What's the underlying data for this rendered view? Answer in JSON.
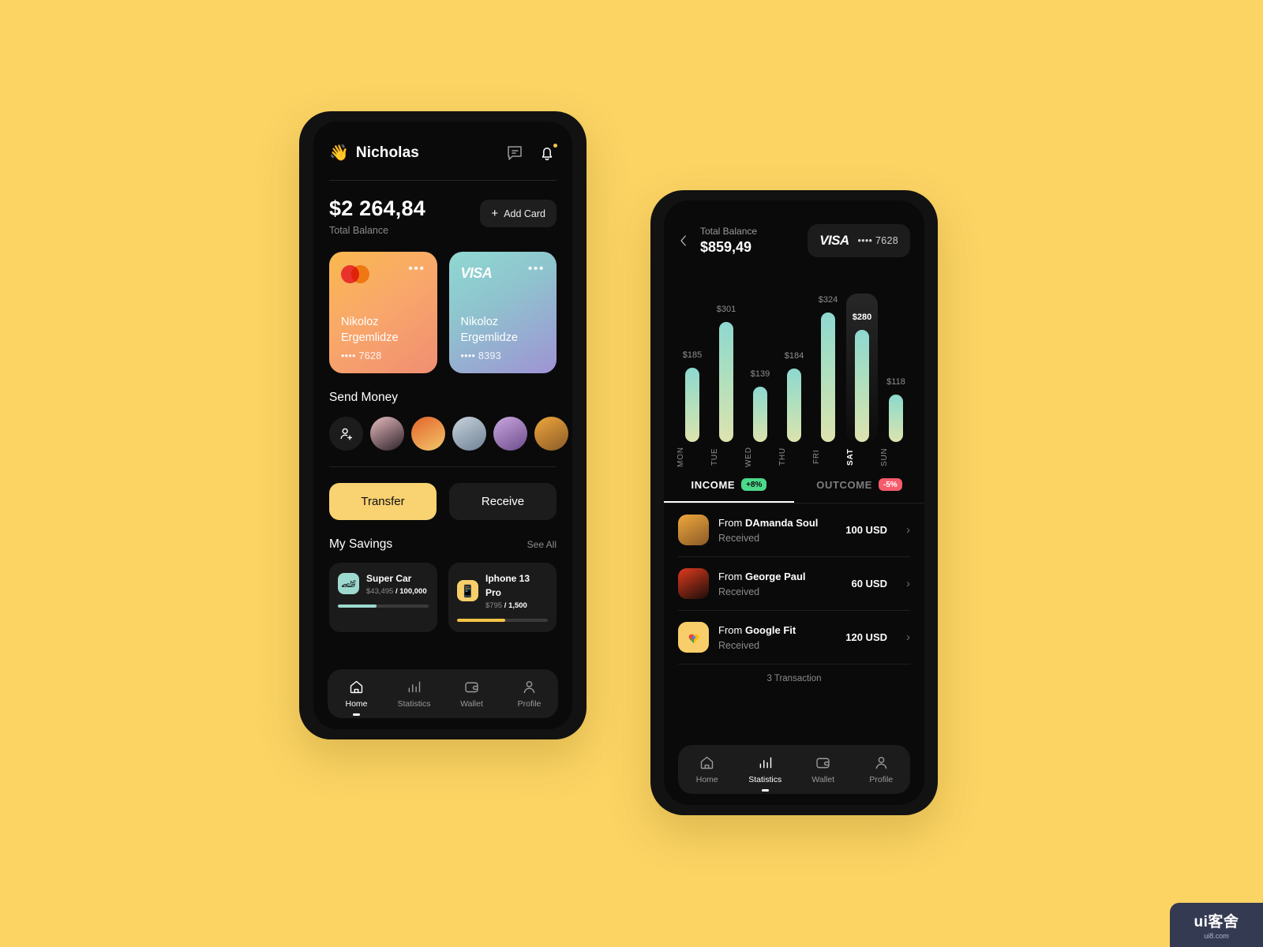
{
  "background_color": "#FBD464",
  "phone1": {
    "header": {
      "wave_emoji": "👋",
      "user_name": "Nicholas",
      "message_icon": "message-bubble-icon",
      "bell_icon": "notification-bell-icon"
    },
    "balance": {
      "amount": "$2 264,84",
      "label": "Total Balance",
      "add_card_label": "Add Card"
    },
    "cards": [
      {
        "brand": "mastercard",
        "holder_line1": "Nikoloz",
        "holder_line2": "Ergemlidze",
        "number": "•••• 7628",
        "menu": "•••"
      },
      {
        "brand": "VISA",
        "holder_line1": "Nikoloz",
        "holder_line2": "Ergemlidze",
        "number": "•••• 8393",
        "menu": "•••"
      }
    ],
    "send_money": {
      "title": "Send Money",
      "add_contact_icon": "add-person-icon",
      "contacts": [
        {
          "name": "contact-1",
          "colors": [
            "#E8BCC0",
            "#2C2028"
          ]
        },
        {
          "name": "contact-2",
          "colors": [
            "#E2642A",
            "#F4C66B"
          ]
        },
        {
          "name": "contact-3",
          "colors": [
            "#C9D3DC",
            "#6E8296"
          ]
        },
        {
          "name": "contact-4",
          "colors": [
            "#C9A8E0",
            "#6E4C8C"
          ]
        },
        {
          "name": "contact-5",
          "colors": [
            "#F0A83C",
            "#8A5A28"
          ]
        }
      ]
    },
    "actions": {
      "transfer_label": "Transfer",
      "receive_label": "Receive"
    },
    "savings": {
      "title": "My Savings",
      "see_all_label": "See All",
      "items": [
        {
          "icon": "race-car-icon",
          "emoji": "🏎",
          "name": "Super Car",
          "current": "$43,495",
          "separator": " / ",
          "goal": "100,000",
          "progress_pct": 43,
          "bar_color": "#9DD9CF",
          "tile_color": "#9DD9CF"
        },
        {
          "icon": "phone-icon",
          "emoji": "📱",
          "name": "Iphone 13 Pro",
          "current": "$795",
          "separator": " / ",
          "goal": "1,500",
          "progress_pct": 53,
          "bar_color": "#F5C councils",
          "tile_color": "#F7CE6A"
        }
      ]
    },
    "nav": {
      "items": [
        {
          "label": "Home",
          "icon": "home-icon",
          "active": true
        },
        {
          "label": "Statistics",
          "icon": "bar-chart-icon",
          "active": false
        },
        {
          "label": "Wallet",
          "icon": "wallet-icon",
          "active": false
        },
        {
          "label": "Profile",
          "icon": "person-icon",
          "active": false
        }
      ]
    }
  },
  "phone2": {
    "header": {
      "back_icon": "chevron-left-icon",
      "balance_label": "Total Balance",
      "balance_amount": "$859,49",
      "card_brand": "VISA",
      "card_number": "•••• 7628"
    },
    "chart_data": {
      "type": "bar",
      "title": "",
      "categories": [
        "MON",
        "TUE",
        "WED",
        "THU",
        "FRI",
        "SAT",
        "SUN"
      ],
      "values": [
        185,
        301,
        139,
        184,
        324,
        280,
        118
      ],
      "labels": [
        "$185",
        "$301",
        "$139",
        "$184",
        "$324",
        "$280",
        "$118"
      ],
      "highlighted_index": 5,
      "ylim": [
        0,
        360
      ],
      "xlabel": "",
      "ylabel": "",
      "grid": false,
      "bar_gradient": [
        "#8ED8D0",
        "#DDE3AE"
      ],
      "currency": "USD"
    },
    "tabs": [
      {
        "label": "INCOME",
        "badge": "+8%",
        "badge_color": "#4CD98A",
        "active": true
      },
      {
        "label": "OUTCOME",
        "badge": "-5%",
        "badge_color": "#F65B6B",
        "active": false
      }
    ],
    "transactions": [
      {
        "prefix": "From ",
        "name": "DAmanda Soul",
        "status": "Received",
        "amount": "100 USD",
        "icon": "avatar-amanda",
        "tile_colors": [
          "#F0A83C",
          "#8A5A28"
        ]
      },
      {
        "prefix": "From ",
        "name": "George Paul",
        "status": "Received",
        "amount": "60 USD",
        "icon": "avatar-george",
        "tile_colors": [
          "#E03A1E",
          "#1A0E0A"
        ]
      },
      {
        "prefix": "From ",
        "name": "Google Fit",
        "status": "Received",
        "amount": "120 USD",
        "icon": "google-fit-icon",
        "tile_colors": [
          "#F7CE6A",
          "#F7CE6A"
        ]
      }
    ],
    "transaction_count": "3 Transaction",
    "nav": {
      "items": [
        {
          "label": "Home",
          "icon": "home-icon",
          "active": false
        },
        {
          "label": "Statistics",
          "icon": "bar-chart-icon",
          "active": true
        },
        {
          "label": "Wallet",
          "icon": "wallet-icon",
          "active": false
        },
        {
          "label": "Profile",
          "icon": "person-icon",
          "active": false
        }
      ]
    }
  },
  "watermark": {
    "main": "ui客舍",
    "sub": "ui8.com"
  }
}
